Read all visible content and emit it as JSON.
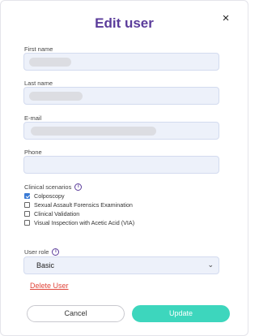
{
  "dialog": {
    "title": "Edit user",
    "close_icon": "×"
  },
  "fields": {
    "first_name_label": "First name",
    "last_name_label": "Last name",
    "email_label": "E-mail",
    "phone_label": "Phone"
  },
  "clinical": {
    "label": "Clinical scenarios",
    "info_icon": "i",
    "options": [
      {
        "label": "Colposcopy",
        "checked": true
      },
      {
        "label": "Sexual Assault Forensics Examination",
        "checked": false
      },
      {
        "label": "Clinical Validation",
        "checked": false
      },
      {
        "label": "Visual Inspection with Acetic Acid (VIA)",
        "checked": false
      }
    ]
  },
  "role": {
    "label": "User role",
    "info_icon": "i",
    "selected": "Basic",
    "chevron": "⌄"
  },
  "actions": {
    "delete_label": "Delete User",
    "cancel_label": "Cancel",
    "update_label": "Update"
  },
  "colors": {
    "title": "#5b3c9b",
    "field_bg": "#edf1fa",
    "checkbox_checked": "#3a7bd5",
    "delete": "#e0453a",
    "update_button": "#3dd6bd"
  }
}
